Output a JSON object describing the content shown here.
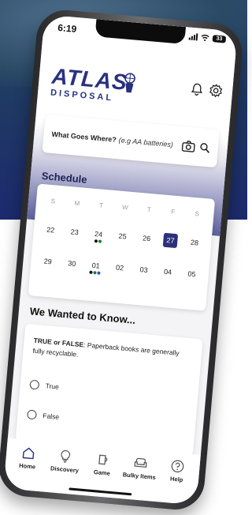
{
  "status": {
    "time": "6:19",
    "battery": "33"
  },
  "brand": {
    "name": "ATLAS",
    "tagline": "DISPOSAL"
  },
  "search": {
    "label": "What Goes Where?",
    "placeholder": "(e.g AA batteries)"
  },
  "schedule": {
    "title": "Schedule",
    "weekdays": [
      "S",
      "M",
      "T",
      "W",
      "T",
      "F",
      "S"
    ],
    "week1": [
      "22",
      "23",
      "24",
      "25",
      "26",
      "27",
      "28"
    ],
    "week2": [
      "29",
      "30",
      "01",
      "02",
      "03",
      "04",
      "05"
    ],
    "selected_day": "27",
    "colors": {
      "selected": "#2c3178",
      "dot_black": "#111111",
      "dot_green": "#1f7a3c",
      "dot_blue": "#2a5aa8"
    }
  },
  "quiz": {
    "title": "We Wanted to Know...",
    "prefix": "TRUE or FALSE",
    "question": ": Paperback books are generally fully recyclable.",
    "options": [
      "True",
      "False"
    ]
  },
  "tabs": [
    {
      "label": "Home",
      "icon": "home-icon"
    },
    {
      "label": "Discovery",
      "icon": "lightbulb-icon"
    },
    {
      "label": "Game",
      "icon": "game-icon"
    },
    {
      "label": "Bulky Items",
      "icon": "couch-icon"
    },
    {
      "label": "Help",
      "icon": "help-icon"
    }
  ]
}
